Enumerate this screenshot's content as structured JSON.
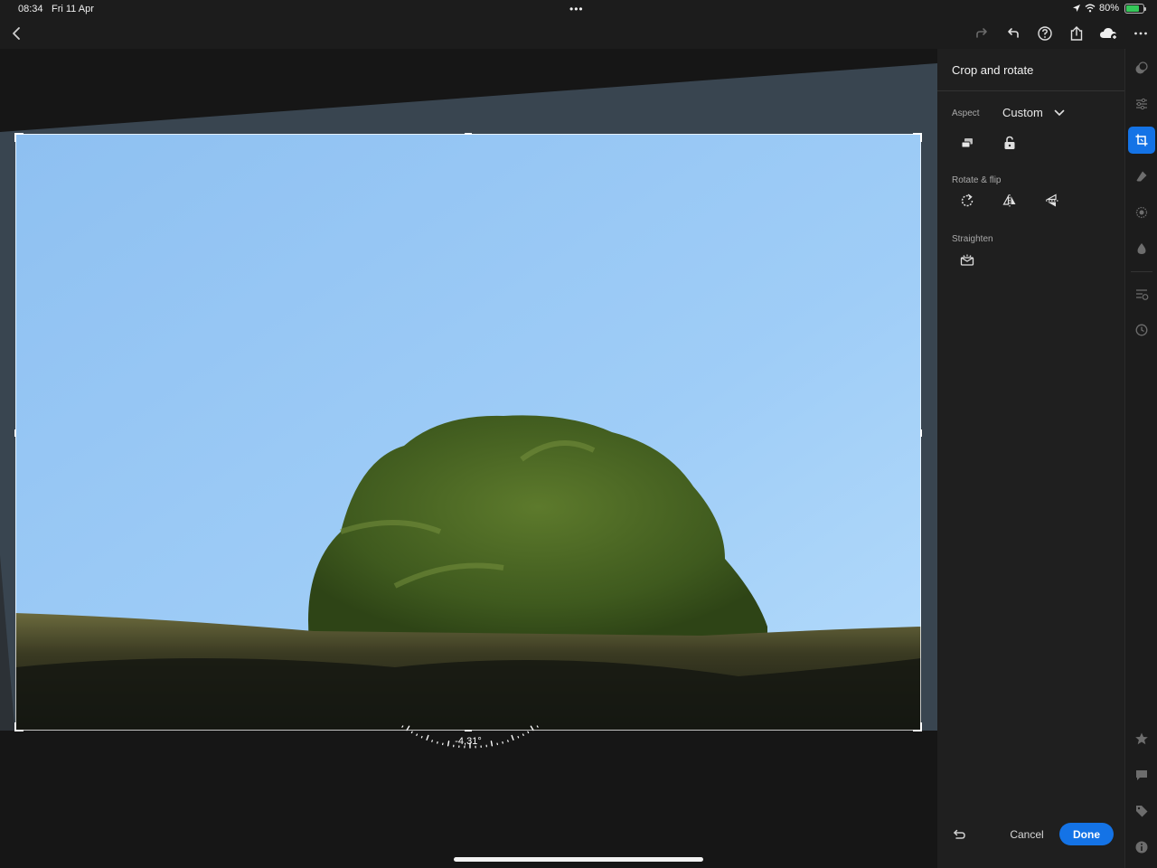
{
  "status_bar": {
    "time": "08:34",
    "date": "Fri 11 Apr",
    "battery": "80%",
    "battery_level": 0.8
  },
  "toolbar": {
    "back_icon": "chevron-left-icon",
    "redo_icon": "redo-icon",
    "undo_icon": "undo-icon",
    "help_icon": "help-icon",
    "share_icon": "share-icon",
    "cloud_icon": "cloud-sync-icon",
    "more_icon": "more-icon"
  },
  "canvas": {
    "angle": "-4,31°"
  },
  "panel": {
    "title": "Crop and rotate",
    "aspect_label": "Aspect",
    "aspect_value": "Custom",
    "rotate_label": "Rotate & flip",
    "straighten_label": "Straighten",
    "cancel_label": "Cancel",
    "done_label": "Done"
  },
  "colors": {
    "accent": "#1473e6",
    "panel_bg": "#1f1f1f",
    "app_bg": "#1c1c1c"
  }
}
